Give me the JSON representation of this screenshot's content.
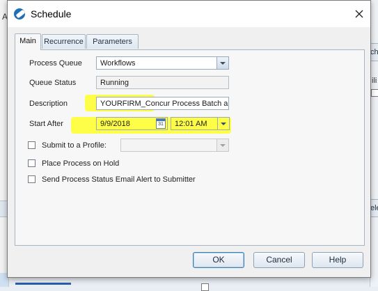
{
  "background": {
    "left_letter": "A",
    "right_tab_fragment": "ch",
    "right_fragment_1": "ili",
    "right_fragment_2": "Se",
    "right_tab2_fragment": "ele"
  },
  "dialog": {
    "title": "Schedule",
    "tabs": [
      {
        "label": "Main",
        "active": true
      },
      {
        "label": "Recurrence",
        "active": false
      },
      {
        "label": "Parameters",
        "active": false
      }
    ],
    "form": {
      "process_queue_label": "Process Queue",
      "process_queue_value": "Workflows",
      "queue_status_label": "Queue Status",
      "queue_status_value": "Running",
      "description_label": "Description",
      "description_value": "YOURFIRM_Concur Process Batch an",
      "start_after_label": "Start After",
      "start_date_value": "9/9/2018",
      "start_time_value": "12:01 AM",
      "calendar_icon_text": "31",
      "submit_profile_label": "Submit to a Profile:",
      "submit_profile_value": "",
      "place_on_hold_label": "Place Process on Hold",
      "send_alert_label": "Send Process Status Email Alert to Submitter"
    },
    "checkboxes": {
      "submit_to_profile": false,
      "place_on_hold": false,
      "send_alert": false
    },
    "buttons": {
      "ok": "OK",
      "cancel": "Cancel",
      "help": "Help"
    }
  },
  "colors": {
    "highlight": "#ffff2a",
    "accent": "#1f6fb5"
  }
}
